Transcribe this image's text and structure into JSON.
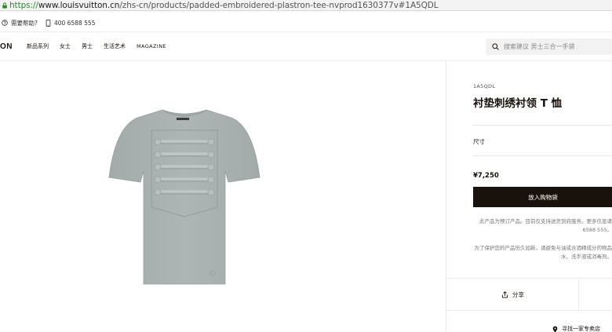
{
  "browser": {
    "url_scheme": "https://",
    "url_host": "www.louisvuitton.cn",
    "url_path": "/zhs-cn/products/padded-embroidered-plastron-tee-nvprod1630377v#1A5QDL"
  },
  "utility": {
    "help_label": "需要帮助?",
    "phone": "400 6588 555"
  },
  "nav": {
    "brand": "ON",
    "items": [
      {
        "label": "新品系列"
      },
      {
        "label": "女士"
      },
      {
        "label": "男士"
      },
      {
        "label": "生活艺术"
      },
      {
        "label": "MAGAZINE"
      }
    ],
    "active_item": "男士",
    "search_placeholder": "搜索建议 男士三合一手袋"
  },
  "product": {
    "sku": "1A5QDL",
    "title": "衬垫刺绣衬领 T 恤",
    "size_label": "尺寸",
    "price": "¥7,250",
    "add_to_cart": "放入购物袋",
    "note1_line1": "此产品为预订产品。目前仅支持送货到府服务。更多信息请",
    "note1_line2": "6588 555。",
    "note2_line1": "为了保护您的产品历久如新，请避免与油或含酒精成分的物品",
    "note2_line2": "水、洗手液或消毒剂。",
    "share_label": "分享",
    "store_label": "寻找一家专卖店"
  },
  "colors": {
    "brand_dark": "#19110b",
    "tee_gray": "#a9b0b0",
    "url_green": "#2e8b2e"
  },
  "icons": [
    "lock-icon",
    "help-icon",
    "phone-icon",
    "search-icon",
    "share-icon",
    "location-pin-icon"
  ]
}
